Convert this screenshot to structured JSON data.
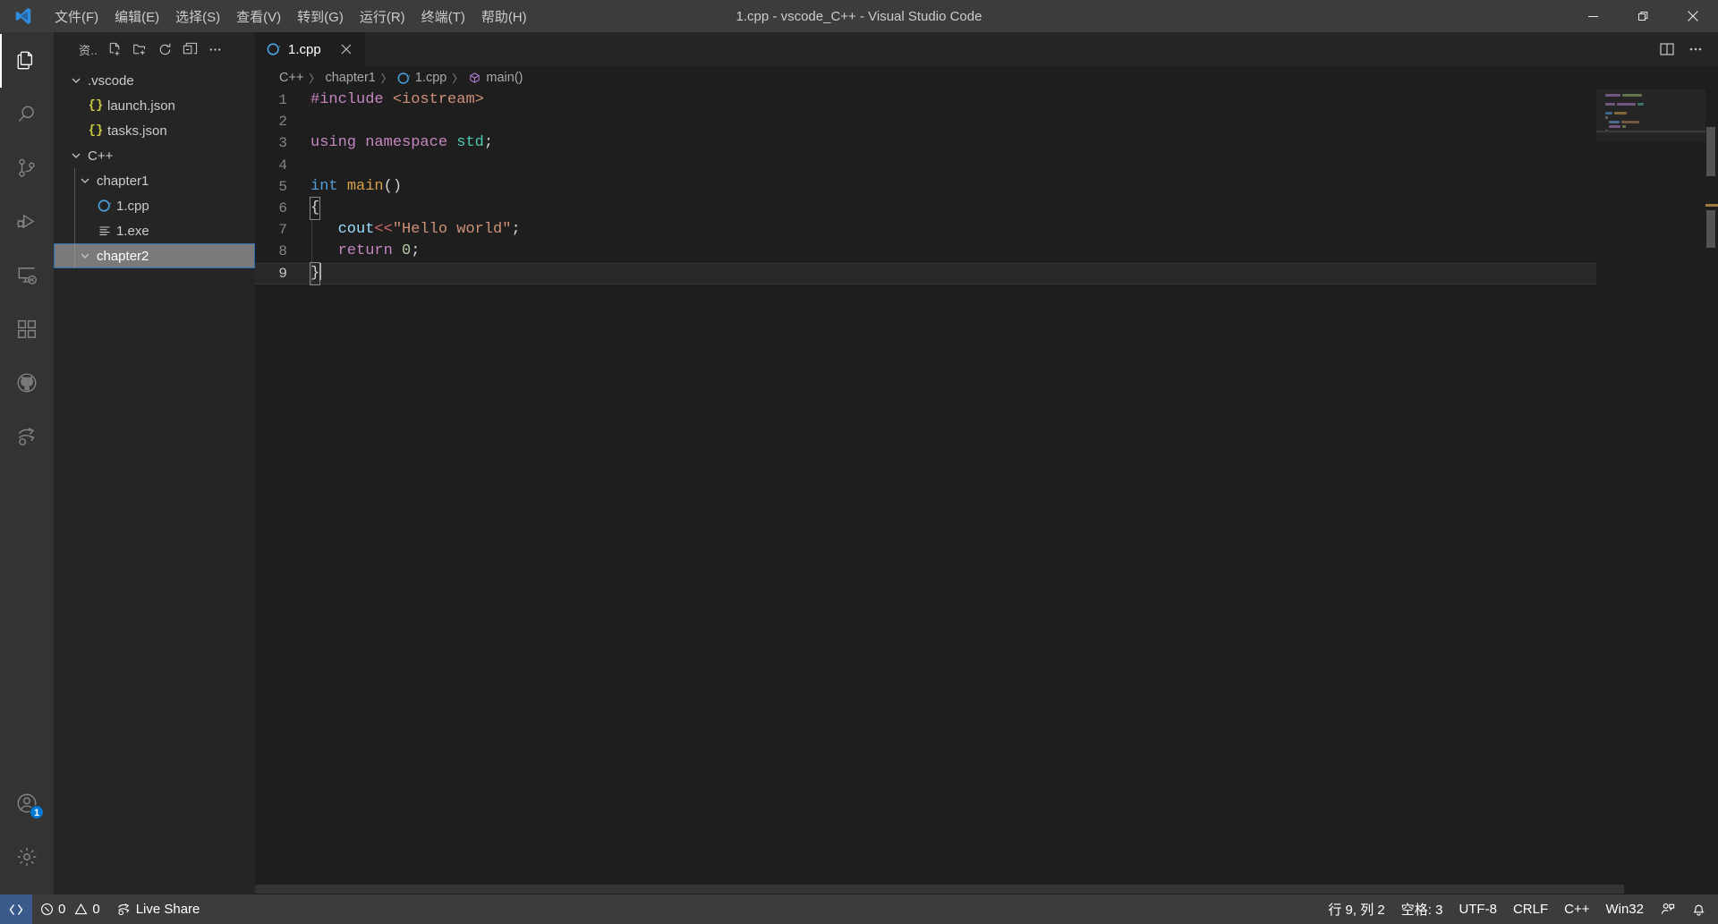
{
  "window": {
    "title": "1.cpp - vscode_C++ - Visual Studio Code",
    "logo_name": "vscode-logo",
    "minimize_label": "—",
    "restore_label": "❐",
    "close_label": "✕"
  },
  "menubar": {
    "items": [
      {
        "label": "文件(F)",
        "name": "menu-file"
      },
      {
        "label": "编辑(E)",
        "name": "menu-edit"
      },
      {
        "label": "选择(S)",
        "name": "menu-selection"
      },
      {
        "label": "查看(V)",
        "name": "menu-view"
      },
      {
        "label": "转到(G)",
        "name": "menu-go"
      },
      {
        "label": "运行(R)",
        "name": "menu-run"
      },
      {
        "label": "终端(T)",
        "name": "menu-terminal"
      },
      {
        "label": "帮助(H)",
        "name": "menu-help"
      }
    ]
  },
  "activitybar": {
    "items": [
      {
        "name": "explorer-icon",
        "label": "资源管理器",
        "active": true
      },
      {
        "name": "search-icon",
        "label": "搜索",
        "active": false
      },
      {
        "name": "source-control-icon",
        "label": "源代码管理",
        "active": false
      },
      {
        "name": "run-debug-icon",
        "label": "运行和调试",
        "active": false
      },
      {
        "name": "remote-explorer-icon",
        "label": "远程资源管理器",
        "active": false
      },
      {
        "name": "extensions-icon",
        "label": "扩展",
        "active": false
      },
      {
        "name": "github-icon",
        "label": "GitHub",
        "active": false
      },
      {
        "name": "live-share-icon",
        "label": "Live Share",
        "active": false
      }
    ],
    "account_badge": "1",
    "account_name": "account-icon",
    "settings_name": "manage-gear-icon"
  },
  "sidebar": {
    "title": "资..",
    "actions": [
      {
        "name": "new-file-icon",
        "label": "新建文件"
      },
      {
        "name": "new-folder-icon",
        "label": "新建文件夹"
      },
      {
        "name": "refresh-icon",
        "label": "刷新资源管理器"
      },
      {
        "name": "collapse-all-icon",
        "label": "在资源管理器中折叠文件夹"
      },
      {
        "name": "more-actions-icon",
        "label": "视图和更多操作..."
      }
    ],
    "tree": [
      {
        "label": ".vscode",
        "type": "folder",
        "depth": 0,
        "expanded": true,
        "icon": "chevron-down-icon",
        "state": ""
      },
      {
        "label": "launch.json",
        "type": "json",
        "depth": 1,
        "expanded": null,
        "icon": "json-file-icon",
        "state": ""
      },
      {
        "label": "tasks.json",
        "type": "json",
        "depth": 1,
        "expanded": null,
        "icon": "json-file-icon",
        "state": ""
      },
      {
        "label": "C++",
        "type": "folder",
        "depth": 0,
        "expanded": true,
        "icon": "chevron-down-icon",
        "state": ""
      },
      {
        "label": "chapter1",
        "type": "folder",
        "depth": 1,
        "expanded": true,
        "icon": "chevron-down-icon",
        "state": ""
      },
      {
        "label": "1.cpp",
        "type": "cpp",
        "depth": 2,
        "expanded": null,
        "icon": "cpp-file-icon",
        "state": ""
      },
      {
        "label": "1.exe",
        "type": "exe",
        "depth": 2,
        "expanded": null,
        "icon": "binary-file-icon",
        "state": ""
      },
      {
        "label": "chapter2",
        "type": "folder",
        "depth": 1,
        "expanded": true,
        "icon": "chevron-down-icon",
        "state": "focused"
      }
    ]
  },
  "editor": {
    "tab": {
      "label": "1.cpp",
      "icon": "cpp-file-icon",
      "close_label": "✕",
      "active": true
    },
    "actions": [
      {
        "name": "split-editor-icon",
        "label": "拆分编辑器"
      },
      {
        "name": "more-actions-icon",
        "label": "更多操作..."
      }
    ],
    "breadcrumb": [
      {
        "label": "C++",
        "icon": ""
      },
      {
        "label": "chapter1",
        "icon": ""
      },
      {
        "label": "1.cpp",
        "icon": "cpp-file-icon"
      },
      {
        "label": "main()",
        "icon": "symbol-method-icon"
      }
    ],
    "breadcrumb_separator": "〉",
    "lines": [
      {
        "n": "1",
        "text": "#include <iostream>"
      },
      {
        "n": "2",
        "text": ""
      },
      {
        "n": "3",
        "text": "using namespace std;"
      },
      {
        "n": "4",
        "text": ""
      },
      {
        "n": "5",
        "text": "int main()"
      },
      {
        "n": "6",
        "text": "{"
      },
      {
        "n": "7",
        "text": "   cout<<\"Hello world\";"
      },
      {
        "n": "8",
        "text": "   return 0;"
      },
      {
        "n": "9",
        "text": "}"
      }
    ],
    "current_line": "9"
  },
  "statusbar": {
    "remote_icon": "remote-window-icon",
    "errors": "0",
    "warnings": "0",
    "error_icon": "error-circle-icon",
    "warning_icon": "warning-triangle-icon",
    "live_share_icon": "live-share-icon",
    "live_share_label": "Live Share",
    "cursor_position": "行 9, 列 2",
    "indentation": "空格: 3",
    "encoding": "UTF-8",
    "eol": "CRLF",
    "language": "C++",
    "platform": "Win32",
    "feedback_icon": "feedback-icon",
    "bell_icon": "bell-icon"
  },
  "colors": {
    "titlebar_bg": "#3c3c3c",
    "activitybar_bg": "#333333",
    "sidebar_bg": "#252526",
    "editor_bg": "#1e1e1e",
    "statusbar_bg": "#3c3c3c",
    "remote_bg": "#3a5a8c",
    "accent": "#0078d4",
    "focus_border": "#2f6ab1",
    "keyword": "#569cd6",
    "string": "#ce9178",
    "preprocessor": "#c586c0",
    "namespace": "#4ec9b0",
    "function": "#dcdcaa",
    "variable": "#9cdcfe",
    "number": "#b5cea8"
  }
}
